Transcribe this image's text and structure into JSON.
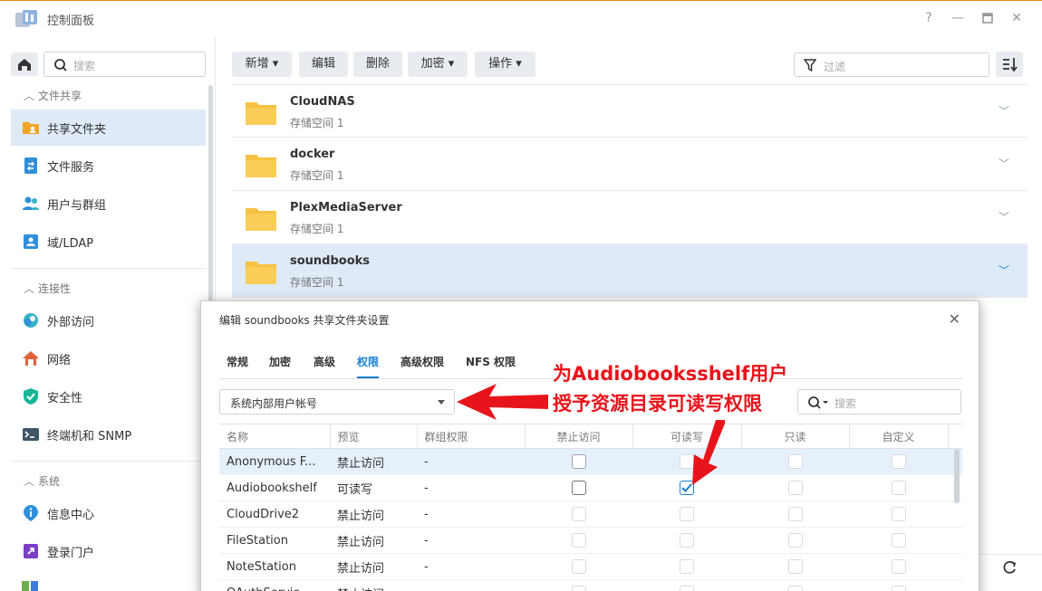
{
  "window": {
    "title": "控制面板"
  },
  "sidebar": {
    "search_placeholder": "搜索",
    "sections": [
      {
        "label": "文件共享"
      },
      {
        "label": "连接性"
      },
      {
        "label": "系统"
      }
    ],
    "items": [
      {
        "label": "共享文件夹",
        "icon": "shared-folder-icon"
      },
      {
        "label": "文件服务",
        "icon": "file-services-icon"
      },
      {
        "label": "用户与群组",
        "icon": "users-groups-icon"
      },
      {
        "label": "域/LDAP",
        "icon": "domain-ldap-icon"
      },
      {
        "label": "外部访问",
        "icon": "external-access-icon"
      },
      {
        "label": "网络",
        "icon": "network-icon"
      },
      {
        "label": "安全性",
        "icon": "security-icon"
      },
      {
        "label": "终端机和 SNMP",
        "icon": "terminal-snmp-icon"
      },
      {
        "label": "信息中心",
        "icon": "info-center-icon"
      },
      {
        "label": "登录门户",
        "icon": "login-portal-icon"
      }
    ]
  },
  "toolbar": {
    "create": "新增",
    "edit": "编辑",
    "delete": "删除",
    "encrypt": "加密",
    "action": "操作",
    "filter_placeholder": "过滤"
  },
  "folders": [
    {
      "name": "CloudNAS",
      "volume": "存储空间 1"
    },
    {
      "name": "docker",
      "volume": "存储空间 1"
    },
    {
      "name": "PlexMediaServer",
      "volume": "存储空间 1"
    },
    {
      "name": "soundbooks",
      "volume": "存储空间 1"
    }
  ],
  "dialog": {
    "title": "编辑 soundbooks 共享文件夹设置",
    "tabs": [
      "常规",
      "加密",
      "高级",
      "权限",
      "高级权限",
      "NFS 权限"
    ],
    "active_tab": "权限",
    "user_type": "系统内部用户帐号",
    "search_placeholder": "搜索",
    "columns": [
      "名称",
      "预览",
      "群组权限",
      "禁止访问",
      "可读写",
      "只读",
      "自定义"
    ],
    "rows": [
      {
        "name": "Anonymous F...",
        "preview": "禁止访问",
        "group": "-",
        "deny": false,
        "rw": false,
        "ro": false,
        "custom": false
      },
      {
        "name": "Audiobookshelf",
        "preview": "可读写",
        "group": "-",
        "deny": false,
        "rw": true,
        "ro": false,
        "custom": false
      },
      {
        "name": "CloudDrive2",
        "preview": "禁止访问",
        "group": "-",
        "deny": false,
        "rw": false,
        "ro": false,
        "custom": false
      },
      {
        "name": "FileStation",
        "preview": "禁止访问",
        "group": "-",
        "deny": false,
        "rw": false,
        "ro": false,
        "custom": false
      },
      {
        "name": "NoteStation",
        "preview": "禁止访问",
        "group": "-",
        "deny": false,
        "rw": false,
        "ro": false,
        "custom": false
      },
      {
        "name": "OAuthServic...",
        "preview": "禁止访问",
        "group": "-",
        "deny": false,
        "rw": false,
        "ro": false,
        "custom": false
      }
    ]
  },
  "annotation": {
    "line1": "为Audiobooksshelf用户",
    "line2": "授予资源目录可读写权限",
    "color": "#e8141b"
  }
}
